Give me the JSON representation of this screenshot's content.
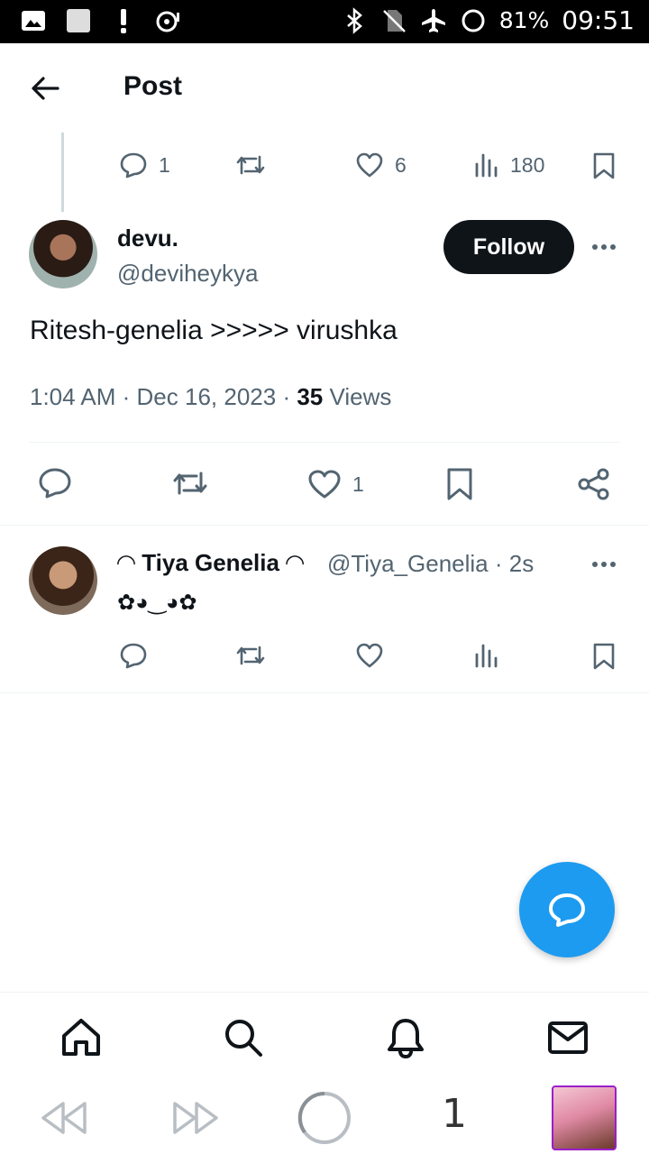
{
  "status_bar": {
    "battery": "81%",
    "time": "09:51"
  },
  "header": {
    "title": "Post"
  },
  "parent_tweet_stats": {
    "replies": "1",
    "likes": "6",
    "views": "180"
  },
  "main_tweet": {
    "display_name": "devu.",
    "handle": "@deviheykya",
    "follow_label": "Follow",
    "text": "Ritesh-genelia >>>>> virushka",
    "time": "1:04 AM",
    "date": "Dec 16, 2023",
    "views_count": "35",
    "views_label": "Views",
    "likes": "1"
  },
  "reply_tweet": {
    "display_name": "◠ Tiya Genelia ◠",
    "handle": "@Tiya_Genelia",
    "age": "2s",
    "text": "✿◕‿◕✿"
  },
  "bottom_nav": {
    "items": [
      "home-icon",
      "search-icon",
      "notifications-icon",
      "messages-icon"
    ]
  },
  "system_nav": {
    "tab_count": "1"
  },
  "colors": {
    "accent": "#1d9bf0",
    "text_primary": "#0f1419",
    "text_secondary": "#536471",
    "thumb_border": "#9b1fc9"
  }
}
